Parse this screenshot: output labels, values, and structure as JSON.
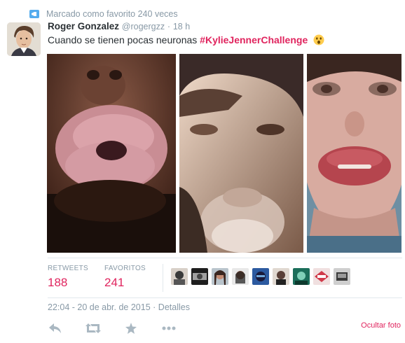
{
  "context": {
    "text": "Marcado como favorito 240 veces",
    "icon": "promoted-favorite-icon"
  },
  "user": {
    "name": "Roger Gonzalez",
    "handle": "@rogergzz",
    "separator": "·",
    "time": "18 h"
  },
  "tweet": {
    "text": "Cuando se tienen pocas neuronas ",
    "hashtag": "#KylieJennerChallenge",
    "emoji": "astonished-face-icon"
  },
  "photos": [
    "kylie-lips-photo-1",
    "kylie-lips-photo-2",
    "kylie-lips-photo-3"
  ],
  "stats": {
    "retweets_label": "RETWEETS",
    "retweets": "188",
    "favorites_label": "FAVORITOS",
    "favorites": "241",
    "favoriters_count": 9
  },
  "timestamp": {
    "date": "22:04 - 20 de abr. de 2015",
    "separator": "·",
    "details_link": "Detalles"
  },
  "actions": [
    "reply-icon",
    "retweet-icon",
    "favorite-icon",
    "more-icon"
  ],
  "hide_photo": "Ocultar foto",
  "colors": {
    "accent": "#e0245e",
    "muted": "#8899a6",
    "text": "#292f33",
    "border": "#e1e8ed"
  }
}
